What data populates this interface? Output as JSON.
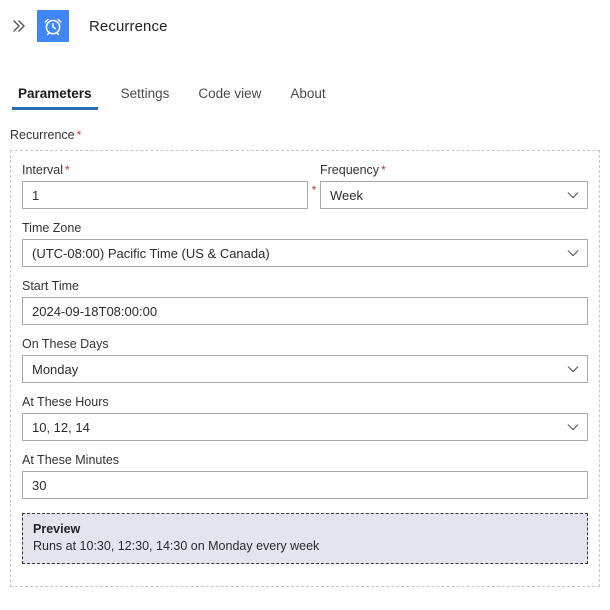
{
  "header": {
    "expand_icon": "double-chevron-right-icon",
    "app_icon": "alarm-clock-icon",
    "title": "Recurrence",
    "icon_color": "#4285f4"
  },
  "tabs": {
    "accent_color": "#2b6cb8",
    "items": [
      {
        "label": "Parameters",
        "active": true
      },
      {
        "label": "Settings",
        "active": false
      },
      {
        "label": "Code view",
        "active": false
      },
      {
        "label": "About",
        "active": false
      }
    ]
  },
  "section": {
    "label": "Recurrence",
    "required_marker": "*",
    "required_color": "#c0392b"
  },
  "fields": {
    "interval": {
      "label": "Interval",
      "required_marker": "*",
      "value": "1",
      "trailing_required_marker": "*",
      "has_chevron": false
    },
    "frequency": {
      "label": "Frequency",
      "required_marker": "*",
      "value": "Week",
      "has_chevron": true,
      "chevron_icon": "chevron-down-icon"
    },
    "time_zone": {
      "label": "Time Zone",
      "value": "(UTC-08:00) Pacific Time (US & Canada)",
      "has_chevron": true,
      "chevron_icon": "chevron-down-icon"
    },
    "start_time": {
      "label": "Start Time",
      "value": "2024-09-18T08:00:00",
      "has_chevron": false
    },
    "on_these_days": {
      "label": "On These Days",
      "value": "Monday",
      "has_chevron": true,
      "chevron_icon": "chevron-down-icon"
    },
    "at_these_hours": {
      "label": "At These Hours",
      "value": "10, 12, 14",
      "has_chevron": true,
      "chevron_icon": "chevron-down-icon"
    },
    "at_these_minutes": {
      "label": "At These Minutes",
      "value": "30",
      "has_chevron": false
    }
  },
  "preview": {
    "title": "Preview",
    "text": "Runs at 10:30, 12:30, 14:30 on Monday every week",
    "background_color": "#e4e4ef"
  }
}
